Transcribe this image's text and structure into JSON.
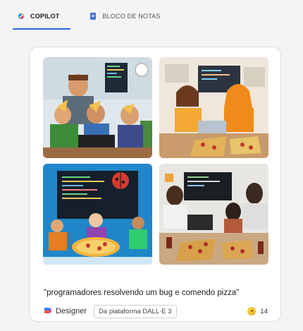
{
  "tabs": [
    {
      "label": "COPILOT",
      "active": true,
      "icon": "copilot-icon"
    },
    {
      "label": "BLOCO DE NOTAS",
      "active": false,
      "icon": "notebook-icon"
    }
  ],
  "images": [
    {
      "name": "image-1",
      "style": "3d-cartoon programmers eating pizza"
    },
    {
      "name": "image-2",
      "style": "anime programmers eating pizza"
    },
    {
      "name": "image-3",
      "style": "flat illustration programmers with bug"
    },
    {
      "name": "image-4",
      "style": "photo-style programmers eating pizza"
    }
  ],
  "caption": "\"programadores resolvendo um bug e comendo pizza\"",
  "designer_label": "Designer",
  "platform_label": "Da plataforma DALL·E 3",
  "credits": "14",
  "colors": {
    "accent": "#2a63d6",
    "coin": "#f0b400"
  }
}
